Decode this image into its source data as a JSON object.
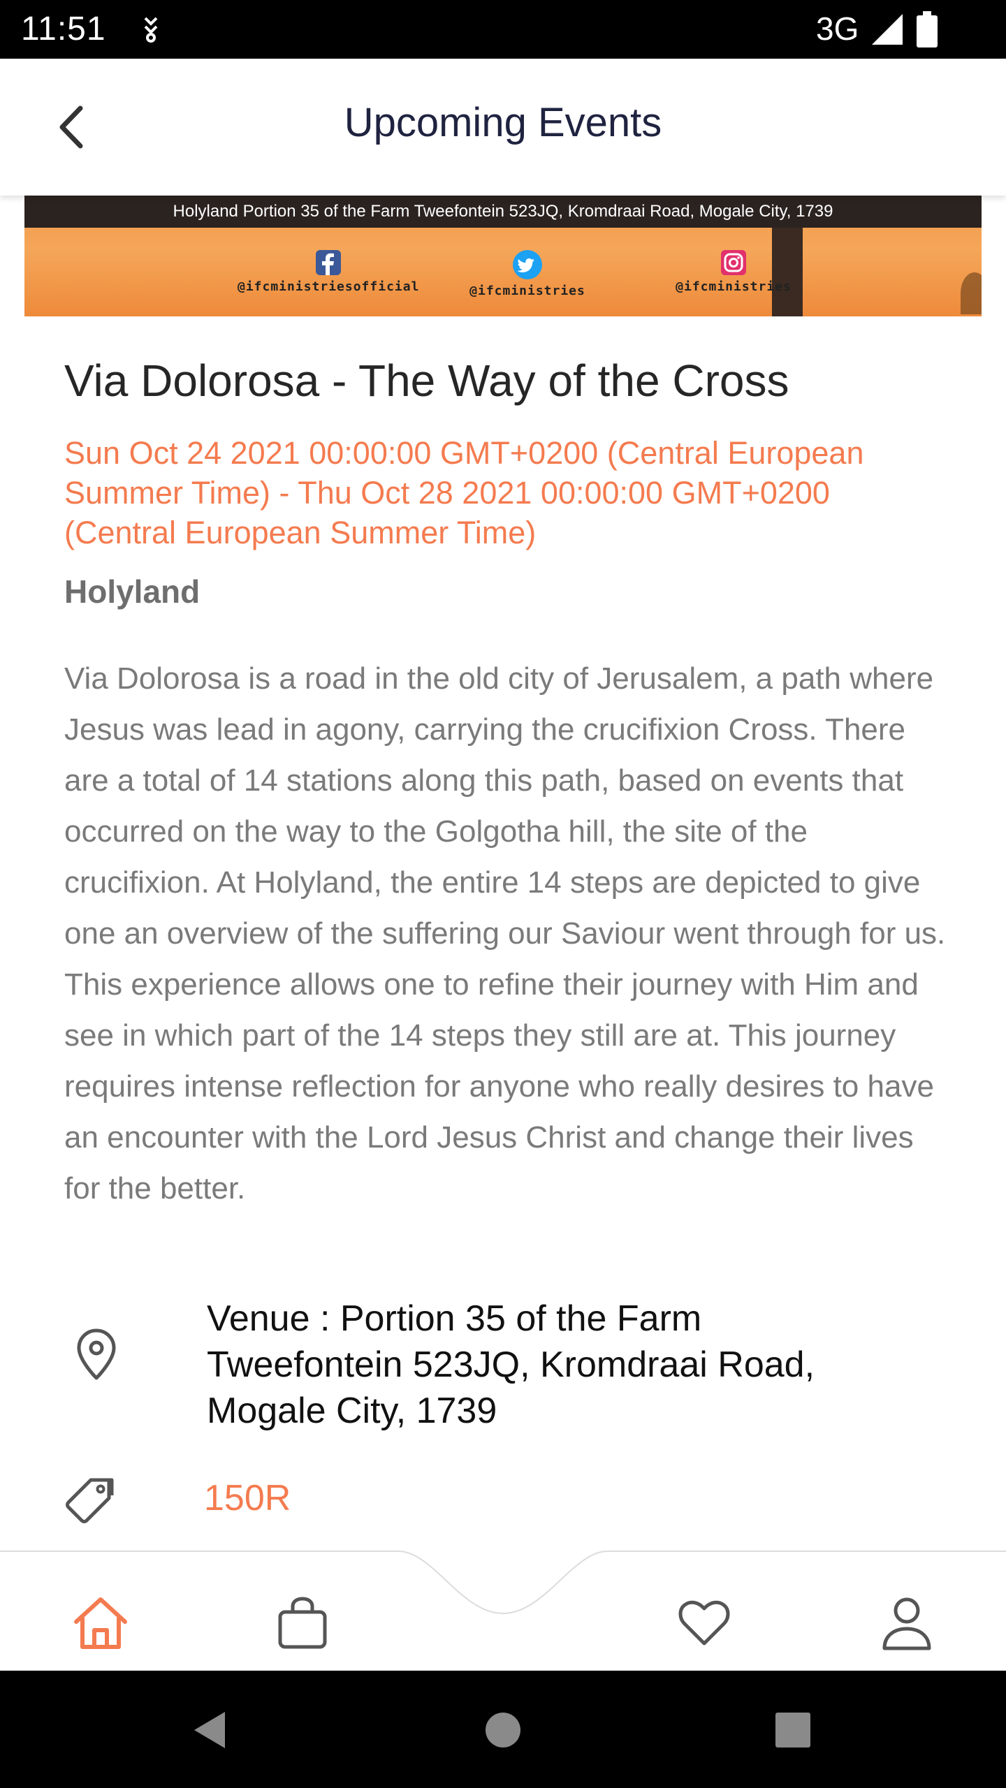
{
  "status_bar": {
    "time": "11:51",
    "network": "3G"
  },
  "app_bar": {
    "title": "Upcoming Events",
    "back_icon": "chevron-left-icon"
  },
  "banner": {
    "address": "Holyland Portion 35 of the Farm Tweefontein 523JQ, Kromdraai Road, Mogale City, 1739",
    "socials": [
      {
        "icon": "facebook-icon",
        "handle": "@ifcministriesofficial"
      },
      {
        "icon": "twitter-icon",
        "handle": "@ifcministries"
      },
      {
        "icon": "instagram-icon",
        "handle": "@ifcministries"
      }
    ]
  },
  "event": {
    "title": "Via Dolorosa - The Way of the Cross",
    "date_range": "Sun Oct 24 2021 00:00:00 GMT+0200 (Central European Summer Time) - Thu Oct 28 2021 00:00:00 GMT+0200 (Central European Summer Time)",
    "place": "Holyland",
    "description": "Via Dolorosa is a road in the old city of Jerusalem, a path where Jesus was lead in agony, carrying the crucifixion Cross. There are a total of 14 stations along this path, based on events that occurred on the way to the Golgotha hill, the site of the crucifixion. At Holyland, the entire 14 steps are depicted to give one an overview of the suffering our Saviour went through for us. This experience allows one to refine their journey with Him and see in which part of the 14 steps they still are at. This journey requires intense reflection for anyone who really desires to have an encounter with the Lord Jesus Christ and change their lives for the better.",
    "venue": "Venue : Portion 35 of the Farm Tweefontein 523JQ, Kromdraai Road, Mogale City, 1739",
    "price": "150R"
  },
  "bottom_nav": {
    "items": [
      {
        "icon": "home-icon",
        "active": true
      },
      {
        "icon": "shopping-bag-icon",
        "active": false
      },
      {
        "icon": "heart-icon",
        "active": false
      },
      {
        "icon": "user-icon",
        "active": false
      }
    ]
  },
  "colors": {
    "accent": "#f47b4f",
    "title_text": "#1f2340",
    "icon_gray": "#555555"
  }
}
